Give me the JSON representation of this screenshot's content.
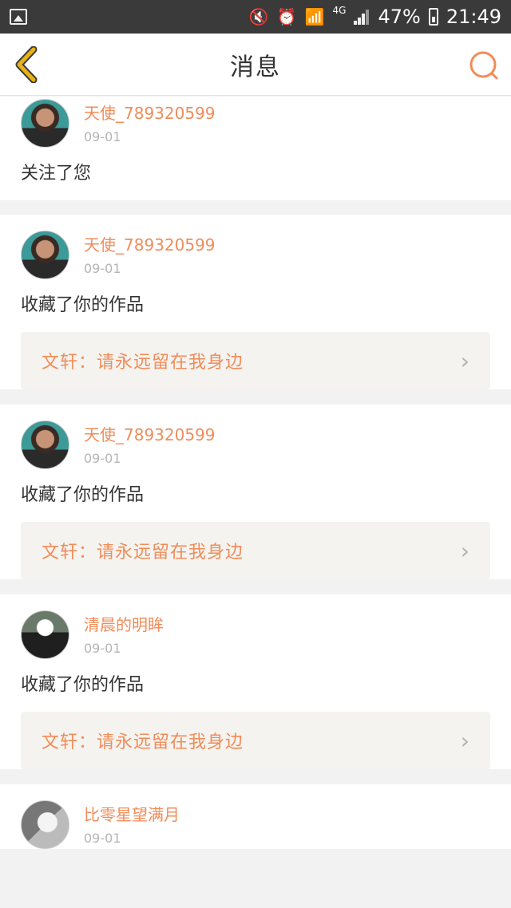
{
  "status_bar": {
    "battery": "47%",
    "time": "21:49",
    "network": "4G"
  },
  "header": {
    "title": "消息"
  },
  "notifications": [
    {
      "username": "天使_789320599",
      "date": "09-01",
      "action": "关注了您"
    },
    {
      "username": "天使_789320599",
      "date": "09-01",
      "action": "收藏了你的作品",
      "work": "文轩：请永远留在我身边"
    },
    {
      "username": "天使_789320599",
      "date": "09-01",
      "action": "收藏了你的作品",
      "work": "文轩：请永远留在我身边"
    },
    {
      "username": "清晨的明眸",
      "date": "09-01",
      "action": "收藏了你的作品",
      "work": "文轩：请永远留在我身边"
    },
    {
      "username": "比零星望满月",
      "date": "09-01"
    }
  ],
  "colors": {
    "accent": "#f08c5a",
    "back_icon": "#e6b21a",
    "status_bar": "#3a3a3a"
  }
}
